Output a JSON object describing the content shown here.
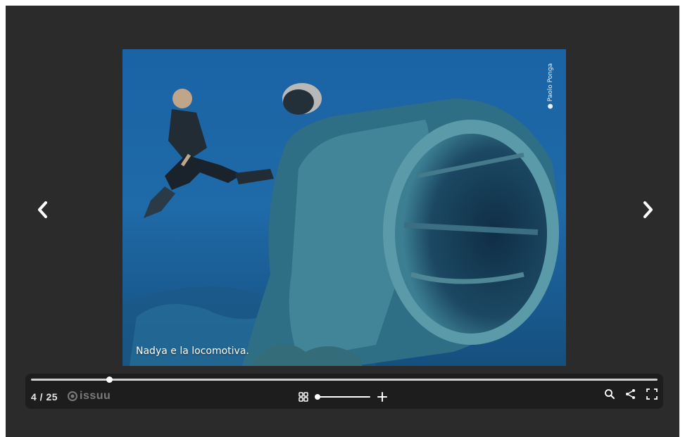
{
  "viewer": {
    "caption": "Nadya e la locomotiva.",
    "photo_credit": "Paolo Ponga"
  },
  "nav": {
    "prev_icon": "chevron-left-icon",
    "next_icon": "chevron-right-icon"
  },
  "toolbar": {
    "page_counter": "4 / 25",
    "brand": "issuu",
    "reading_progress": 0.125,
    "zoom_level": 0.0,
    "icons": {
      "grid": "grid-view-icon",
      "zoom_in": "plus-icon",
      "search": "search-icon",
      "share": "share-icon",
      "fullscreen": "fullscreen-icon"
    }
  },
  "colors": {
    "background": "#2b2b2b",
    "toolbar": "#1d1d1d",
    "water": "#1f5f9a"
  }
}
